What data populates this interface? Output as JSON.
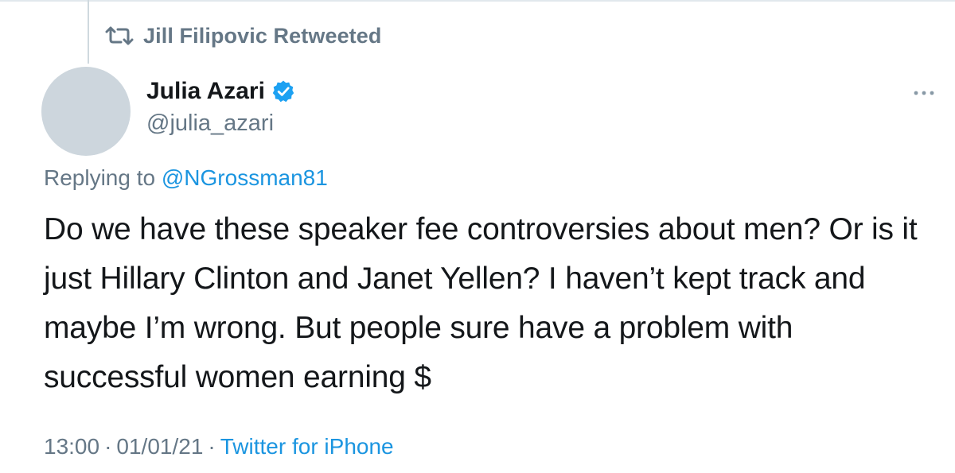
{
  "retweet": {
    "icon": "retweet-icon",
    "text": "Jill Filipovic Retweeted"
  },
  "author": {
    "name": "Julia Azari",
    "verified": true,
    "verified_color": "#1da1f2",
    "handle": "@julia_azari"
  },
  "reply": {
    "prefix": "Replying to ",
    "to": "@NGrossman81"
  },
  "tweet": {
    "text": "Do we have these speaker fee controversies about men? Or is it just Hillary Clinton and Janet Yellen? I haven’t kept track and maybe I’m wrong. But people sure have a problem with successful women earning $"
  },
  "meta": {
    "time": "13:00",
    "date": "01/01/21",
    "source": "Twitter for iPhone",
    "separator": "·"
  },
  "colors": {
    "link": "#1b95e0",
    "muted": "#657786",
    "text": "#14171a"
  }
}
